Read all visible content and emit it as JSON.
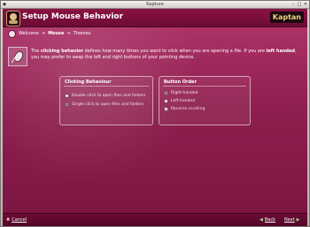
{
  "window": {
    "title": "Kapture"
  },
  "header": {
    "title": "Setup Mouse Behavior",
    "brand": "Kaptan"
  },
  "breadcrumb": {
    "items": [
      "Welcome",
      "Mouse",
      "Themes"
    ]
  },
  "intro": {
    "part1": "The ",
    "bold1": "clicking behavior",
    "part2": " defines how many times you want to click when you are opening a file. If you are ",
    "bold2": "left handed",
    "part3": ", you may prefer to swap the left and right buttons of your pointing device."
  },
  "clicking": {
    "title": "Clicking Behaviour",
    "options": [
      "Double click to open files and folders",
      "Single click to open files and folders"
    ],
    "selected": 1
  },
  "buttonOrder": {
    "title": "Button Order",
    "options": [
      "Right-handed",
      "Left-handed"
    ],
    "selected": 0,
    "reverse_label": "Reverse scrolling",
    "reverse_checked": true
  },
  "footer": {
    "cancel": "Cancel",
    "back": "Back",
    "next": "Next"
  },
  "colors": {
    "accent": "#a1285c",
    "header": "#7a0f3d"
  }
}
